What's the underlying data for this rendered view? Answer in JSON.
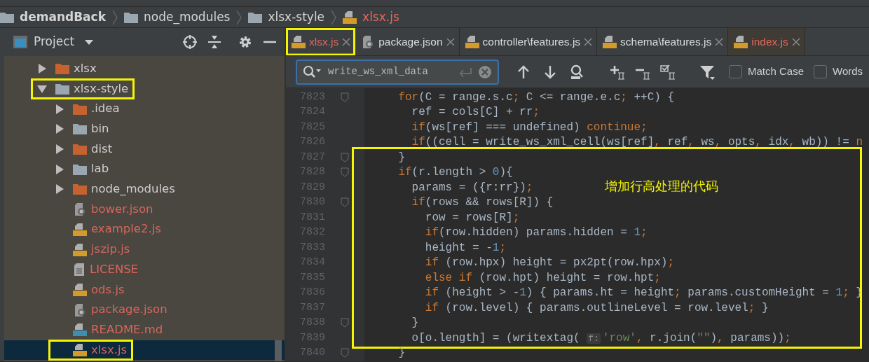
{
  "breadcrumbs": [
    {
      "label": "demandBack",
      "kind": "folder"
    },
    {
      "label": "node_modules",
      "kind": "folder"
    },
    {
      "label": "xlsx-style",
      "kind": "folder"
    },
    {
      "label": "xlsx.js",
      "kind": "js"
    }
  ],
  "project_panel": {
    "title": "Project"
  },
  "tree": [
    {
      "label": "xlsx",
      "kind": "ignored",
      "expanded": false,
      "selected": false,
      "highlighted": false
    },
    {
      "label": "xlsx-style",
      "kind": "folder",
      "expanded": true,
      "selected": false,
      "highlighted": true,
      "children": [
        {
          "label": ".idea",
          "kind": "ignored",
          "expanded": false,
          "selected": false,
          "highlighted": false
        },
        {
          "label": "bin",
          "kind": "folder",
          "expanded": false,
          "selected": false,
          "highlighted": false
        },
        {
          "label": "dist",
          "kind": "ignored",
          "expanded": false,
          "selected": false,
          "highlighted": false
        },
        {
          "label": "lab",
          "kind": "folder",
          "expanded": false,
          "selected": false,
          "highlighted": false
        },
        {
          "label": "node_modules",
          "kind": "ignored",
          "expanded": false,
          "selected": false,
          "highlighted": false
        },
        {
          "label": "bower.json",
          "kind": "json",
          "selected": false,
          "highlighted": false
        },
        {
          "label": "example2.js",
          "kind": "js",
          "selected": false,
          "highlighted": false
        },
        {
          "label": "jszip.js",
          "kind": "js",
          "selected": false,
          "highlighted": false
        },
        {
          "label": "LICENSE",
          "kind": "text",
          "selected": false,
          "highlighted": false
        },
        {
          "label": "ods.js",
          "kind": "js",
          "selected": false,
          "highlighted": false
        },
        {
          "label": "package.json",
          "kind": "json",
          "selected": false,
          "highlighted": false
        },
        {
          "label": "README.md",
          "kind": "md",
          "selected": false,
          "highlighted": false
        },
        {
          "label": "xlsx.js",
          "kind": "js",
          "selected": true,
          "highlighted": true
        }
      ]
    }
  ],
  "tabs": [
    {
      "label": "xlsx.js",
      "kind": "js",
      "color": "#e0685e",
      "selected": true,
      "highlighted": true
    },
    {
      "label": "package.json",
      "kind": "json",
      "color": "#dcdcdc",
      "selected": false,
      "highlighted": false
    },
    {
      "label": "controller\\features.js",
      "kind": "js",
      "color": "#dcdcdc",
      "selected": false,
      "highlighted": false
    },
    {
      "label": "schema\\features.js",
      "kind": "js",
      "color": "#dcdcdc",
      "selected": false,
      "highlighted": false
    },
    {
      "label": "index.js",
      "kind": "js",
      "color": "#e0685e",
      "selected": false,
      "highlighted": false
    }
  ],
  "find_bar": {
    "value": "write_ws_xml_data",
    "options": [
      {
        "label": "Match Case",
        "checked": false
      },
      {
        "label": "Words",
        "checked": false
      }
    ]
  },
  "code_blocks": [
    {
      "boxed": false,
      "lines": [
        {
          "number": "7823",
          "fold": true,
          "tokens": [
            {
              "kind": "keyword",
              "text": "    for"
            },
            {
              "kind": "plain",
              "text": "(C = range.s.c"
            },
            {
              "kind": "keyword",
              "text": ";"
            },
            {
              "kind": "plain",
              "text": " C <= range.e.c"
            },
            {
              "kind": "keyword",
              "text": ";"
            },
            {
              "kind": "plain",
              "text": " ++C) {"
            }
          ]
        },
        {
          "number": "7824",
          "fold": false,
          "tokens": [
            {
              "kind": "plain",
              "text": "      ref = cols[C] + rr"
            },
            {
              "kind": "keyword",
              "text": ";"
            }
          ]
        },
        {
          "number": "7825",
          "fold": false,
          "tokens": [
            {
              "kind": "keyword",
              "text": "      if"
            },
            {
              "kind": "plain",
              "text": "(ws[ref] === undefined) "
            },
            {
              "kind": "keyword",
              "text": "continue;"
            }
          ]
        },
        {
          "number": "7826",
          "fold": false,
          "tokens": [
            {
              "kind": "keyword",
              "text": "      if"
            },
            {
              "kind": "plain",
              "text": "((cell = write_ws_xml_cell(ws[ref]"
            },
            {
              "kind": "keyword",
              "text": ","
            },
            {
              "kind": "plain",
              "text": " ref"
            },
            {
              "kind": "keyword",
              "text": ","
            },
            {
              "kind": "plain",
              "text": " ws"
            },
            {
              "kind": "keyword",
              "text": ","
            },
            {
              "kind": "plain",
              "text": " opts"
            },
            {
              "kind": "keyword",
              "text": ","
            },
            {
              "kind": "plain",
              "text": " idx"
            },
            {
              "kind": "keyword",
              "text": ","
            },
            {
              "kind": "plain",
              "text": " wb)) != "
            },
            {
              "kind": "keyword",
              "text": "n"
            }
          ]
        }
      ]
    },
    {
      "boxed": true,
      "note": "增加行高处理的代码",
      "lines": [
        {
          "number": "7827",
          "fold": true,
          "tokens": [
            {
              "kind": "plain",
              "text": "    }"
            }
          ]
        },
        {
          "number": "7828",
          "fold": true,
          "tokens": [
            {
              "kind": "keyword",
              "text": "    if"
            },
            {
              "kind": "plain",
              "text": "(r.length > "
            },
            {
              "kind": "number",
              "text": "0"
            },
            {
              "kind": "plain",
              "text": "){"
            }
          ]
        },
        {
          "number": "7829",
          "fold": false,
          "tokens": [
            {
              "kind": "plain",
              "text": "      params = ({r:rr})"
            },
            {
              "kind": "keyword",
              "text": ";"
            }
          ]
        },
        {
          "number": "7830",
          "fold": true,
          "tokens": [
            {
              "kind": "keyword",
              "text": "      if"
            },
            {
              "kind": "plain",
              "text": "(rows && rows[R]) {"
            }
          ]
        },
        {
          "number": "7831",
          "fold": false,
          "tokens": [
            {
              "kind": "plain",
              "text": "        row = rows[R]"
            },
            {
              "kind": "keyword",
              "text": ";"
            }
          ]
        },
        {
          "number": "7832",
          "fold": false,
          "tokens": [
            {
              "kind": "keyword",
              "text": "        if"
            },
            {
              "kind": "plain",
              "text": "(row.hidden) params.hidden = "
            },
            {
              "kind": "number",
              "text": "1"
            },
            {
              "kind": "keyword",
              "text": ";"
            }
          ]
        },
        {
          "number": "7833",
          "fold": false,
          "tokens": [
            {
              "kind": "plain",
              "text": "        height = -"
            },
            {
              "kind": "number",
              "text": "1"
            },
            {
              "kind": "keyword",
              "text": ";"
            }
          ]
        },
        {
          "number": "7834",
          "fold": false,
          "tokens": [
            {
              "kind": "keyword",
              "text": "        if"
            },
            {
              "kind": "plain",
              "text": " (row.hpx) height = px2pt(row.hpx)"
            },
            {
              "kind": "keyword",
              "text": ";"
            }
          ]
        },
        {
          "number": "7835",
          "fold": false,
          "tokens": [
            {
              "kind": "keyword",
              "text": "        else if"
            },
            {
              "kind": "plain",
              "text": " (row.hpt) height = row.hpt"
            },
            {
              "kind": "keyword",
              "text": ";"
            }
          ]
        },
        {
          "number": "7836",
          "fold": false,
          "tokens": [
            {
              "kind": "keyword",
              "text": "        if"
            },
            {
              "kind": "plain",
              "text": " (height > -"
            },
            {
              "kind": "number",
              "text": "1"
            },
            {
              "kind": "plain",
              "text": ") { params.ht = height"
            },
            {
              "kind": "keyword",
              "text": ";"
            },
            {
              "kind": "plain",
              "text": " params.customHeight = "
            },
            {
              "kind": "number",
              "text": "1"
            },
            {
              "kind": "keyword",
              "text": ";"
            },
            {
              "kind": "plain",
              "text": " }"
            }
          ]
        },
        {
          "number": "7837",
          "fold": false,
          "tokens": [
            {
              "kind": "keyword",
              "text": "        if"
            },
            {
              "kind": "plain",
              "text": " (row.level) { params.outlineLevel = row.level"
            },
            {
              "kind": "keyword",
              "text": ";"
            },
            {
              "kind": "plain",
              "text": " }"
            }
          ]
        },
        {
          "number": "7838",
          "fold": true,
          "tokens": [
            {
              "kind": "plain",
              "text": "      }"
            }
          ]
        },
        {
          "number": "7839",
          "fold": false,
          "tokens": [
            {
              "kind": "plain",
              "text": "      o[o.length] = (writextag( "
            },
            {
              "kind": "hint",
              "text": "f:"
            },
            {
              "kind": "string",
              "text": "'row'"
            },
            {
              "kind": "keyword",
              "text": ","
            },
            {
              "kind": "plain",
              "text": " r.join("
            },
            {
              "kind": "string",
              "text": "\"\""
            },
            {
              "kind": "plain",
              "text": ")"
            },
            {
              "kind": "keyword",
              "text": ","
            },
            {
              "kind": "plain",
              "text": " params))"
            },
            {
              "kind": "keyword",
              "text": ";"
            }
          ]
        }
      ]
    },
    {
      "boxed": false,
      "lines": [
        {
          "number": "7840",
          "fold": true,
          "tokens": [
            {
              "kind": "plain",
              "text": "    }"
            }
          ]
        }
      ]
    }
  ]
}
